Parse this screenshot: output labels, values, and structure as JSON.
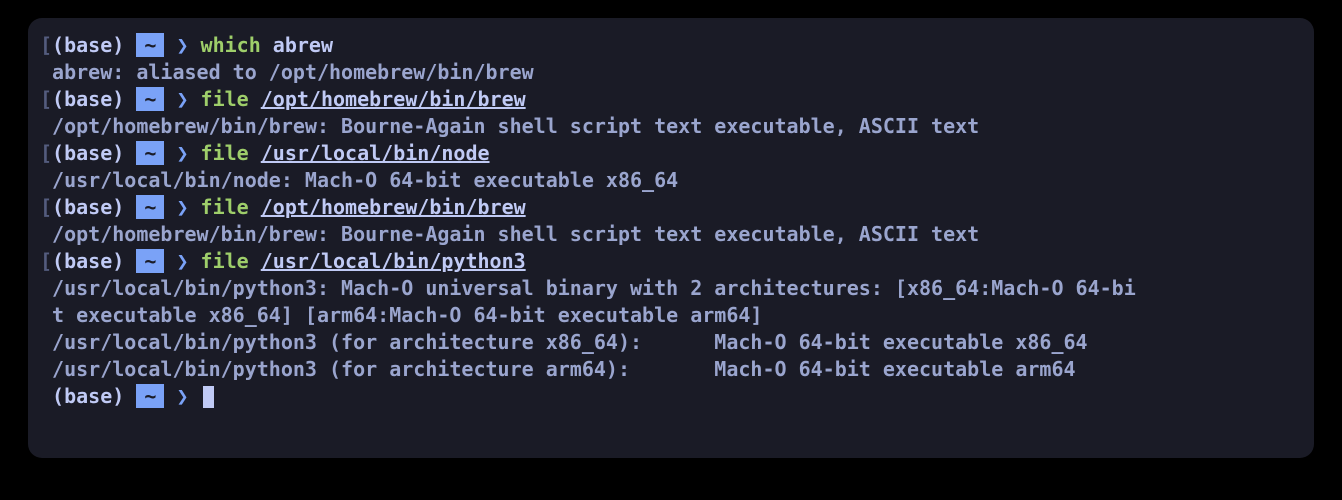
{
  "prompt": {
    "bracket_open": "[",
    "env": "(base)",
    "dir": "~",
    "arrow": "❯"
  },
  "lines": [
    {
      "type": "cmd",
      "command": "which",
      "arg": "abrew",
      "arg_underline": false
    },
    {
      "type": "out",
      "text": " abrew: aliased to /opt/homebrew/bin/brew"
    },
    {
      "type": "cmd",
      "command": "file",
      "arg": "/opt/homebrew/bin/brew",
      "arg_underline": true
    },
    {
      "type": "out",
      "text": " /opt/homebrew/bin/brew: Bourne-Again shell script text executable, ASCII text"
    },
    {
      "type": "cmd",
      "command": "file",
      "arg": "/usr/local/bin/node",
      "arg_underline": true
    },
    {
      "type": "out",
      "text": " /usr/local/bin/node: Mach-O 64-bit executable x86_64"
    },
    {
      "type": "cmd",
      "command": "file",
      "arg": "/opt/homebrew/bin/brew",
      "arg_underline": true
    },
    {
      "type": "out",
      "text": " /opt/homebrew/bin/brew: Bourne-Again shell script text executable, ASCII text"
    },
    {
      "type": "cmd",
      "command": "file",
      "arg": "/usr/local/bin/python3",
      "arg_underline": true
    },
    {
      "type": "out",
      "text": " /usr/local/bin/python3: Mach-O universal binary with 2 architectures: [x86_64:Mach-O 64-bi"
    },
    {
      "type": "out",
      "text": " t executable x86_64] [arm64:Mach-O 64-bit executable arm64]"
    },
    {
      "type": "out",
      "text": " /usr/local/bin/python3 (for architecture x86_64):      Mach-O 64-bit executable x86_64"
    },
    {
      "type": "out",
      "text": " /usr/local/bin/python3 (for architecture arm64):       Mach-O 64-bit executable arm64"
    },
    {
      "type": "prompt_only"
    }
  ]
}
